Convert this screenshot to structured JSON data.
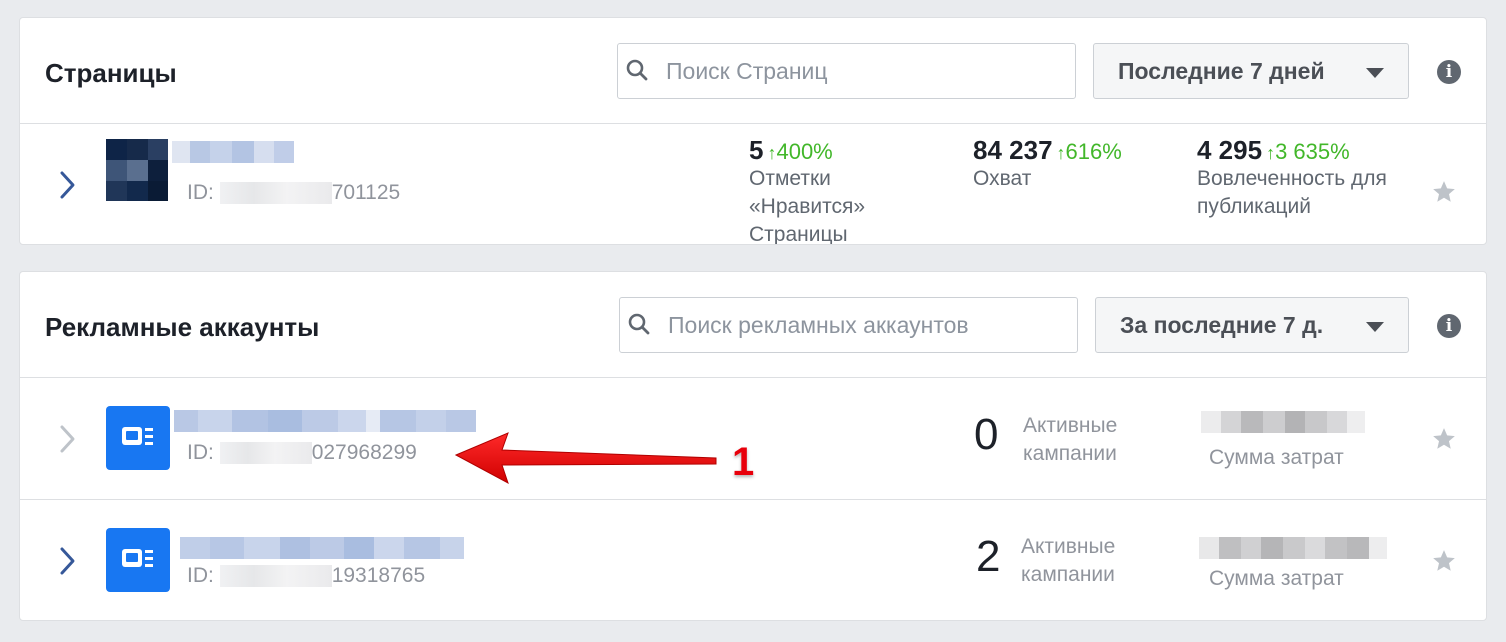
{
  "pages_section": {
    "title": "Страницы",
    "search_placeholder": "Поиск Страниц",
    "range_label": "Последние 7 дней",
    "info_icon": "info-icon",
    "item": {
      "id_prefix": "ID:",
      "id_visible": "701125",
      "likes": {
        "value": "5",
        "change": "400%",
        "label_l1": "Отметки",
        "label_l2": "«Нравится»",
        "label_l3": "Страницы"
      },
      "reach": {
        "value": "84 237",
        "change": "616%",
        "label": "Охват"
      },
      "engagement": {
        "value": "4 295",
        "change": "3 635%",
        "label_l1": "Вовлеченность для",
        "label_l2": "публикаций"
      }
    }
  },
  "ads_section": {
    "title": "Рекламные аккаунты",
    "search_placeholder": "Поиск рекламных аккаунтов",
    "range_label": "За последние 7 д.",
    "accounts": [
      {
        "id_prefix": "ID:",
        "id_visible": "027968299",
        "campaigns": "0",
        "campaigns_label_l1": "Активные",
        "campaigns_label_l2": "кампании",
        "spend_label": "Сумма затрат"
      },
      {
        "id_prefix": "ID:",
        "id_visible": "19318765",
        "campaigns": "2",
        "campaigns_label_l1": "Активные",
        "campaigns_label_l2": "кампании",
        "spend_label": "Сумма затрат"
      }
    ]
  },
  "annotation": {
    "number": "1",
    "color": "#e8000b"
  },
  "colors": {
    "accent_blue": "#1877f2",
    "chevron_blue": "#365899",
    "green_up": "#42b72a"
  }
}
